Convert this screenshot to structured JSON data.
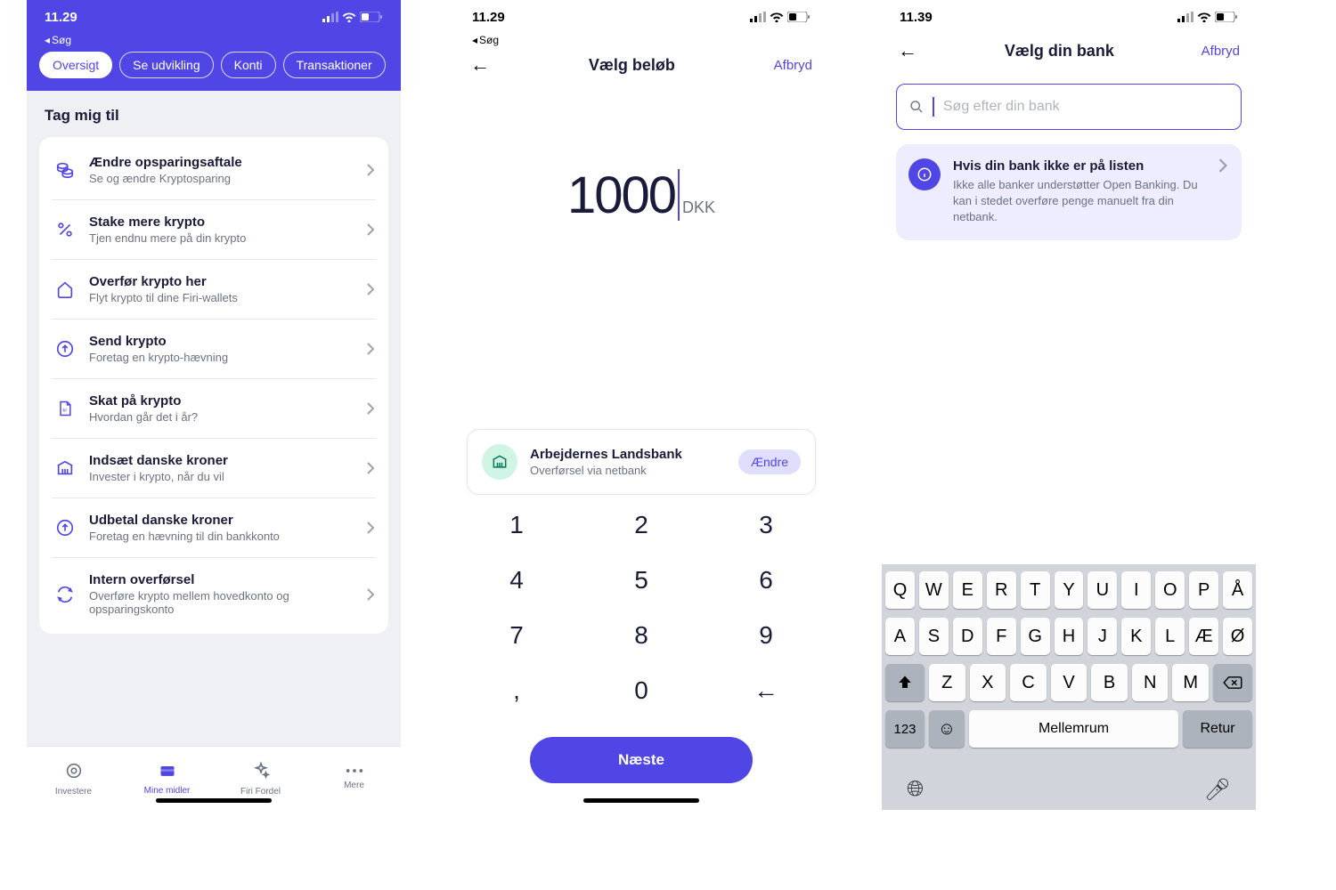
{
  "status": {
    "time1": "11.29",
    "time2": "11.29",
    "time3": "11.39",
    "back_search": "Søg"
  },
  "p1": {
    "tabs": [
      "Oversigt",
      "Se udvikling",
      "Konti",
      "Transaktioner"
    ],
    "active_tab": 0,
    "heading": "Tag mig til",
    "items": [
      {
        "icon": "coins",
        "title": "Ændre opsparingsaftale",
        "sub": "Se og ændre Kryptosparing"
      },
      {
        "icon": "percent",
        "title": "Stake mere krypto",
        "sub": "Tjen endnu mere på din krypto"
      },
      {
        "icon": "home",
        "title": "Overfør krypto her",
        "sub": "Flyt krypto til dine Firi-wallets"
      },
      {
        "icon": "up",
        "title": "Send krypto",
        "sub": "Foretag en krypto-hævning"
      },
      {
        "icon": "doc",
        "title": "Skat på krypto",
        "sub": "Hvordan går det i år?"
      },
      {
        "icon": "bank",
        "title": "Indsæt danske kroner",
        "sub": "Invester i krypto, når du vil"
      },
      {
        "icon": "up",
        "title": "Udbetal danske kroner",
        "sub": "Foretag en hævning til din bankkonto"
      },
      {
        "icon": "cycle",
        "title": "Intern overførsel",
        "sub": "Overføre krypto mellem hovedkonto og opsparingskonto"
      }
    ],
    "tabbar": [
      {
        "label": "Investere",
        "icon": "target"
      },
      {
        "label": "Mine midler",
        "icon": "wallet"
      },
      {
        "label": "Firi Fordel",
        "icon": "sparkle"
      },
      {
        "label": "Mere",
        "icon": "more"
      }
    ],
    "active_bottom": 1
  },
  "p2": {
    "title": "Vælg beløb",
    "cancel": "Afbryd",
    "amount": "1000",
    "currency": "DKK",
    "bank_name": "Arbejdernes Landsbank",
    "bank_sub": "Overførsel via netbank",
    "change": "Ændre",
    "keypad": [
      [
        "1",
        "2",
        "3"
      ],
      [
        "4",
        "5",
        "6"
      ],
      [
        "7",
        "8",
        "9"
      ],
      [
        ",",
        "0",
        "←"
      ]
    ],
    "next": "Næste"
  },
  "p3": {
    "title": "Vælg din bank",
    "cancel": "Afbryd",
    "search_placeholder": "Søg efter din bank",
    "info_title": "Hvis din bank ikke er på listen",
    "info_desc": "Ikke alle banker understøtter Open Banking. Du kan i stedet overføre penge manuelt fra din netbank.",
    "keyboard_rows": [
      [
        "Q",
        "W",
        "E",
        "R",
        "T",
        "Y",
        "U",
        "I",
        "O",
        "P",
        "Å"
      ],
      [
        "A",
        "S",
        "D",
        "F",
        "G",
        "H",
        "J",
        "K",
        "L",
        "Æ",
        "Ø"
      ],
      [
        "Z",
        "X",
        "C",
        "V",
        "B",
        "N",
        "M"
      ]
    ],
    "kb_123": "123",
    "kb_space": "Mellemrum",
    "kb_return": "Retur"
  }
}
